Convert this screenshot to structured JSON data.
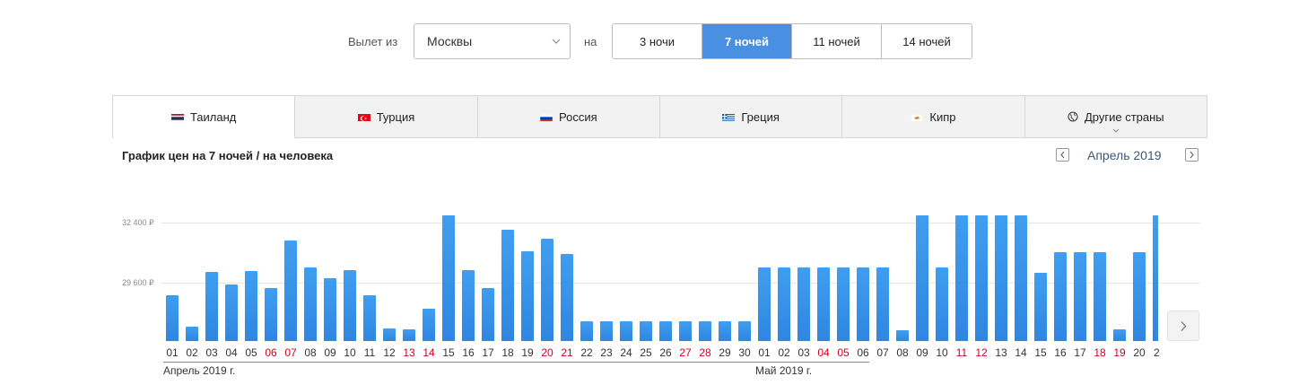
{
  "filters": {
    "departure_label": "Вылет из",
    "departure_city": "Москвы",
    "nights_label": "на",
    "nights_options": [
      "3 ночи",
      "7 ночей",
      "11 ночей",
      "14 ночей"
    ],
    "nights_selected": "7 ночей"
  },
  "tabs": [
    {
      "label": "Таиланд",
      "flag": "thailand-flag",
      "active": true
    },
    {
      "label": "Турция",
      "flag": "turkey-flag",
      "active": false
    },
    {
      "label": "Россия",
      "flag": "russia-flag",
      "active": false
    },
    {
      "label": "Греция",
      "flag": "greece-flag",
      "active": false
    },
    {
      "label": "Кипр",
      "flag": "cyprus-flag",
      "active": false
    },
    {
      "label": "Другие страны",
      "flag": "globe-icon",
      "active": false
    }
  ],
  "chart_header": {
    "title": "График цен на 7 ночей / на человека",
    "month": "Апрель 2019"
  },
  "colors": {
    "accent": "#4a90e2",
    "bar": "#3b94ea",
    "weekend": "#d0021b"
  },
  "chart_data": {
    "type": "bar",
    "yticks": [
      "32 400 ₽",
      "29 600 ₽"
    ],
    "ytick_values": [
      32400,
      29600
    ],
    "ylim": [
      26860,
      33020
    ],
    "month_labels": [
      "Апрель 2019 г.",
      "Май 2019 г."
    ],
    "categories": [
      "01",
      "02",
      "03",
      "04",
      "05",
      "06",
      "07",
      "08",
      "09",
      "10",
      "11",
      "12",
      "13",
      "14",
      "15",
      "16",
      "17",
      "18",
      "19",
      "20",
      "21",
      "22",
      "23",
      "24",
      "25",
      "26",
      "27",
      "28",
      "29",
      "30",
      "01",
      "02",
      "03",
      "04",
      "05",
      "06",
      "07",
      "08",
      "09",
      "10",
      "11",
      "12",
      "13",
      "14",
      "15",
      "16",
      "17",
      "18",
      "19",
      "20",
      "2"
    ],
    "weekend": [
      false,
      false,
      false,
      false,
      false,
      true,
      true,
      false,
      false,
      false,
      false,
      false,
      true,
      true,
      false,
      false,
      false,
      false,
      false,
      true,
      true,
      false,
      false,
      false,
      false,
      false,
      true,
      true,
      false,
      false,
      false,
      false,
      false,
      true,
      true,
      false,
      false,
      false,
      false,
      false,
      true,
      true,
      false,
      false,
      false,
      false,
      false,
      true,
      true,
      false,
      false
    ],
    "values": [
      29000,
      27560,
      30120,
      29500,
      30160,
      29330,
      31560,
      30290,
      29790,
      30180,
      29000,
      27480,
      27440,
      28370,
      32720,
      30180,
      29330,
      32070,
      31070,
      31630,
      30920,
      27820,
      27820,
      27820,
      27820,
      27820,
      27820,
      27820,
      27820,
      27820,
      30300,
      30300,
      30300,
      30300,
      30300,
      30300,
      30300,
      27400,
      32720,
      30300,
      32720,
      32720,
      32720,
      32720,
      30060,
      31030,
      31030,
      31030,
      27440,
      31030,
      32720
    ]
  }
}
